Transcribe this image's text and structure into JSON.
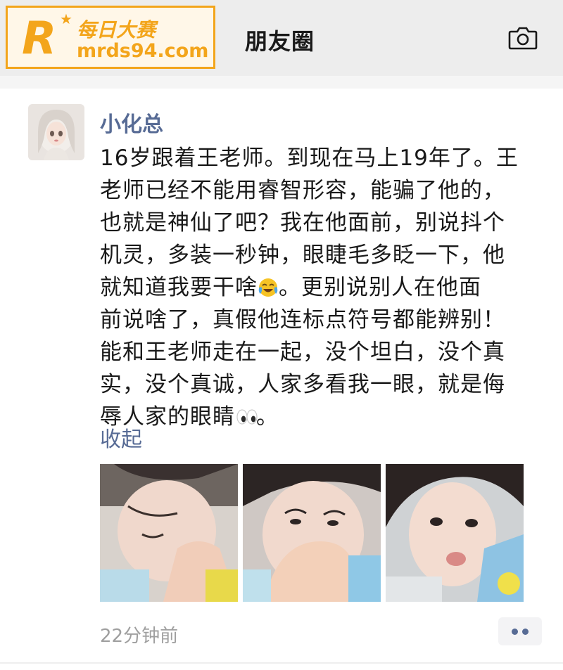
{
  "watermark": {
    "logo_letter": "R",
    "name": "每日大赛",
    "url": "mrds94.com"
  },
  "header": {
    "title": "朋友圈",
    "camera_icon": "camera-icon"
  },
  "post": {
    "author": "小化总",
    "text_lines": [
      "16岁跟着王老师。到现在马上19年了。王",
      "老师已经不能用睿智形容，能骗了他的，",
      "也就是神仙了吧？我在他面前，别说抖个",
      "机灵，多装一秒钟，眼睫毛多眨一下，他",
      "就知道我要干啥",
      "。更别说别人在他面",
      "前说啥了，真假他连标点符号都能辨别！",
      "能和王老师走在一起，没个坦白，没个真",
      "实，没个真诚，人家多看我一眼，就是侮",
      "辱人家的眼睛",
      "。"
    ],
    "emojis": [
      "laughing-crying-emoji",
      "eyes-emoji"
    ],
    "collapse_label": "收起",
    "photos": [
      "photo-1",
      "photo-2",
      "photo-3"
    ],
    "timestamp": "22分钟前",
    "more_icon": "more-dots-icon"
  },
  "colors": {
    "link": "#576b95",
    "logo": "#f3a51b",
    "header_bg": "#ededed"
  }
}
